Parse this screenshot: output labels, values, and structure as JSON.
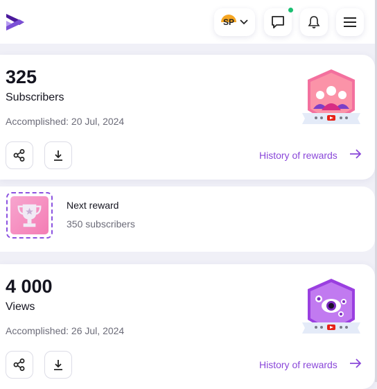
{
  "header": {
    "logo": "play-logo",
    "avatar_initials": "SP",
    "account_menu": "chevron-down-icon",
    "messages_has_notification": true,
    "icons": [
      "chat-icon",
      "bell-icon",
      "menu-icon"
    ]
  },
  "achievements": [
    {
      "value": "325",
      "label": "Subscribers",
      "accomplished": "Accomplished: 20 Jul, 2024",
      "history_label": "History of rewards",
      "badge": "subscribers-badge"
    },
    {
      "value": "4 000",
      "label": "Views",
      "accomplished": "Accomplished: 26 Jul, 2024",
      "history_label": "History of rewards",
      "badge": "views-badge"
    }
  ],
  "next_reward": {
    "title": "Next reward",
    "target": "350 subscribers"
  },
  "colors": {
    "accent": "#8a47d9",
    "notification": "#1bbf72",
    "logo_dark": "#4b1a9c",
    "logo_light": "#a98be8"
  }
}
